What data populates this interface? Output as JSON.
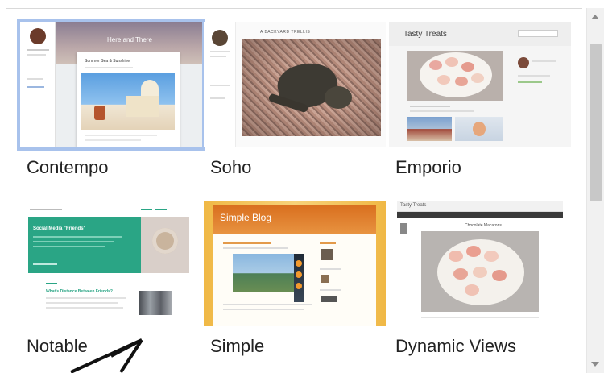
{
  "themes": [
    {
      "name": "Contempo",
      "preview_title": "Here and There",
      "preview_post": "Summer Sea & Sunshine",
      "selected": true
    },
    {
      "name": "Soho",
      "preview_title": "A BACKYARD TRELLIS",
      "selected": false
    },
    {
      "name": "Emporio",
      "preview_title": "Tasty Treats",
      "selected": false
    },
    {
      "name": "Notable",
      "preview_title": "Social Media \"Friends\"",
      "preview_post": "What's Distance Between Friends?",
      "selected": false
    },
    {
      "name": "Simple",
      "preview_title": "Simple Blog",
      "selected": false
    },
    {
      "name": "Dynamic Views",
      "preview_title": "Tasty Treats",
      "preview_post": "Chocolate Macarons",
      "selected": false
    }
  ],
  "colors": {
    "selection_outline": "#a8c2ec",
    "notable_green": "#2aa585",
    "simple_orange": "#e08a2c"
  }
}
